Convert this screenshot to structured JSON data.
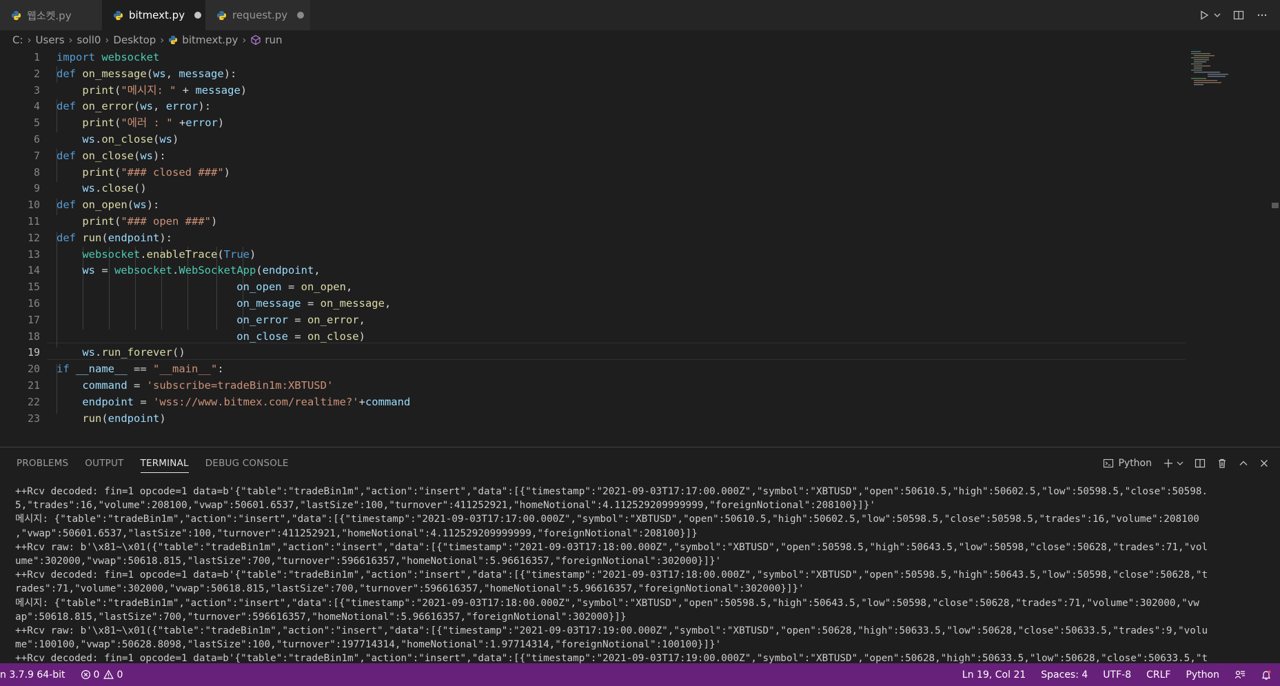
{
  "tabs": [
    {
      "label": "웹소켓.py"
    },
    {
      "label": "bitmext.py"
    },
    {
      "label": "request.py"
    }
  ],
  "breadcrumb": {
    "drive": "C:",
    "folder1": "Users",
    "folder2": "soll0",
    "folder3": "Desktop",
    "file": "bitmext.py",
    "symbol": "run"
  },
  "editor": {
    "line_numbers": [
      "1",
      "2",
      "3",
      "4",
      "5",
      "6",
      "7",
      "8",
      "9",
      "10",
      "11",
      "12",
      "13",
      "14",
      "15",
      "16",
      "17",
      "18",
      "19",
      "20",
      "21",
      "22",
      "23"
    ],
    "current_line": "19",
    "l1_kw": "import",
    "l1_mod": "websocket",
    "l2_kw": "def",
    "l2_fn": "on_message",
    "l2_p1": "ws",
    "l2_p2": "message",
    "l3_fn": "print",
    "l3_str": "\"메시지: \"",
    "l3_var": "message",
    "l4_kw": "def",
    "l4_fn": "on_error",
    "l4_p1": "ws",
    "l4_p2": "error",
    "l5_fn": "print",
    "l5_str": "\"에러 : \"",
    "l5_var": "error",
    "l6_var": "ws",
    "l6_fn": "on_close",
    "l6_arg": "ws",
    "l7_kw": "def",
    "l7_fn": "on_close",
    "l7_p1": "ws",
    "l8_fn": "print",
    "l8_str": "\"### closed ###\"",
    "l9_var": "ws",
    "l9_fn": "close",
    "l10_kw": "def",
    "l10_fn": "on_open",
    "l10_p1": "ws",
    "l11_fn": "print",
    "l11_str": "\"### open ###\"",
    "l12_kw": "def",
    "l12_fn": "run",
    "l12_p1": "endpoint",
    "l13_mod": "websocket",
    "l13_fn": "enableTrace",
    "l13_kw": "True",
    "l14_var": "ws",
    "l14_mod": "websocket",
    "l14_cls": "WebSocketApp",
    "l14_arg": "endpoint",
    "l15_k": "on_open",
    "l15_v": "on_open",
    "l16_k": "on_message",
    "l16_v": "on_message",
    "l17_k": "on_error",
    "l17_v": "on_error",
    "l18_k": "on_close",
    "l18_v": "on_close",
    "l19_var": "ws",
    "l19_fn": "run_forever",
    "l20_kw": "if",
    "l20_var": "__name__",
    "l20_str": "\"__main__\"",
    "l21_var": "command",
    "l21_str": "'subscribe=tradeBin1m:XBTUSD'",
    "l22_var": "endpoint",
    "l22_str": "'wss://www.bitmex.com/realtime?'",
    "l22_var2": "command",
    "l23_fn": "run",
    "l23_arg": "endpoint"
  },
  "panel": {
    "tabs": [
      "PROBLEMS",
      "OUTPUT",
      "TERMINAL",
      "DEBUG CONSOLE"
    ],
    "terminal_profile": "Python",
    "terminal_lines": [
      "++Rcv decoded: fin=1 opcode=1 data=b'{\"table\":\"tradeBin1m\",\"action\":\"insert\",\"data\":[{\"timestamp\":\"2021-09-03T17:17:00.000Z\",\"symbol\":\"XBTUSD\",\"open\":50610.5,\"high\":50602.5,\"low\":50598.5,\"close\":50598.",
      "5,\"trades\":16,\"volume\":208100,\"vwap\":50601.6537,\"lastSize\":100,\"turnover\":411252921,\"homeNotional\":4.112529209999999,\"foreignNotional\":208100}]}'",
      "메시지: {\"table\":\"tradeBin1m\",\"action\":\"insert\",\"data\":[{\"timestamp\":\"2021-09-03T17:17:00.000Z\",\"symbol\":\"XBTUSD\",\"open\":50610.5,\"high\":50602.5,\"low\":50598.5,\"close\":50598.5,\"trades\":16,\"volume\":208100",
      ",\"vwap\":50601.6537,\"lastSize\":100,\"turnover\":411252921,\"homeNotional\":4.112529209999999,\"foreignNotional\":208100}]}",
      "++Rcv raw: b'\\x81~\\x01({\"table\":\"tradeBin1m\",\"action\":\"insert\",\"data\":[{\"timestamp\":\"2021-09-03T17:18:00.000Z\",\"symbol\":\"XBTUSD\",\"open\":50598.5,\"high\":50643.5,\"low\":50598,\"close\":50628,\"trades\":71,\"vol",
      "ume\":302000,\"vwap\":50618.815,\"lastSize\":700,\"turnover\":596616357,\"homeNotional\":5.96616357,\"foreignNotional\":302000}]}'",
      "++Rcv decoded: fin=1 opcode=1 data=b'{\"table\":\"tradeBin1m\",\"action\":\"insert\",\"data\":[{\"timestamp\":\"2021-09-03T17:18:00.000Z\",\"symbol\":\"XBTUSD\",\"open\":50598.5,\"high\":50643.5,\"low\":50598,\"close\":50628,\"t",
      "rades\":71,\"volume\":302000,\"vwap\":50618.815,\"lastSize\":700,\"turnover\":596616357,\"homeNotional\":5.96616357,\"foreignNotional\":302000}]}'",
      "메시지: {\"table\":\"tradeBin1m\",\"action\":\"insert\",\"data\":[{\"timestamp\":\"2021-09-03T17:18:00.000Z\",\"symbol\":\"XBTUSD\",\"open\":50598.5,\"high\":50643.5,\"low\":50598,\"close\":50628,\"trades\":71,\"volume\":302000,\"vw",
      "ap\":50618.815,\"lastSize\":700,\"turnover\":596616357,\"homeNotional\":5.96616357,\"foreignNotional\":302000}]}",
      "++Rcv raw: b'\\x81~\\x01({\"table\":\"tradeBin1m\",\"action\":\"insert\",\"data\":[{\"timestamp\":\"2021-09-03T17:19:00.000Z\",\"symbol\":\"XBTUSD\",\"open\":50628,\"high\":50633.5,\"low\":50628,\"close\":50633.5,\"trades\":9,\"volu",
      "me\":100100,\"vwap\":50628.8098,\"lastSize\":100,\"turnover\":197714314,\"homeNotional\":1.97714314,\"foreignNotional\":100100}]}'",
      "++Rcv decoded: fin=1 opcode=1 data=b'{\"table\":\"tradeBin1m\",\"action\":\"insert\",\"data\":[{\"timestamp\":\"2021-09-03T17:19:00.000Z\",\"symbol\":\"XBTUSD\",\"open\":50628,\"high\":50633.5,\"low\":50628,\"close\":50633.5,\"t"
    ]
  },
  "status": {
    "interpreter": "n 3.7.9 64-bit",
    "errors": "0",
    "warnings": "0",
    "position": "Ln 19, Col 21",
    "spaces": "Spaces: 4",
    "encoding": "UTF-8",
    "eol": "CRLF",
    "language": "Python"
  },
  "colors": {
    "statusbar": "#68217a",
    "keyword": "#569cd6",
    "function": "#dcdcaa",
    "parameter": "#9cdcfe",
    "string": "#ce9178",
    "module": "#4ec9b0"
  },
  "icons": {
    "python_file": "python-icon",
    "run": "run-icon",
    "split_editor": "split-editor-icon",
    "more_actions": "more-icon",
    "symbol": "symbol-method-icon",
    "terminal": "terminal-icon",
    "add_terminal": "plus-icon",
    "trash": "trash-icon",
    "maximize": "chevron-up-icon",
    "close_panel": "close-icon",
    "error": "error-icon",
    "warning": "warning-icon",
    "feedback": "feedback-icon",
    "notifications": "bell-icon"
  }
}
